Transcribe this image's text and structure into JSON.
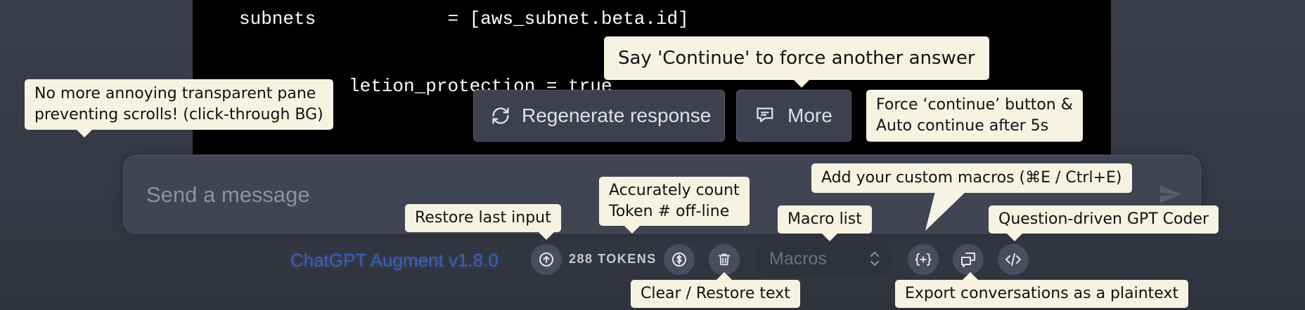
{
  "code": {
    "line1": "subnets            = [aws_subnet.beta.id]",
    "line2": "          letion_protection = true"
  },
  "actions": {
    "regenerate_label": "Regenerate response",
    "more_label": "More"
  },
  "composer": {
    "placeholder": "Send a message"
  },
  "footer": {
    "brand": "ChatGPT Augment v1.8.0",
    "tokens": "288 TOKENS",
    "macros_placeholder": "Macros"
  },
  "tooltips": {
    "continue": "Say 'Continue' to force another answer",
    "scroll_line1": "No more annoying transparent pane",
    "scroll_line2": "preventing scrolls! (click-through BG)",
    "force_line1": "Force ‘continue’ button &",
    "force_line2": "Auto continue after 5s",
    "custom_macros": "Add your custom macros (⌘E / Ctrl+E)",
    "count_line1": "Accurately count",
    "count_line2": "Token # off-line",
    "restore": "Restore last input",
    "macro_list": "Macro list",
    "coder": "Question-driven GPT Coder",
    "clear": "Clear / Restore text",
    "export": "Export conversations as a plaintext"
  },
  "colors": {
    "background": "#3b3e4b",
    "code_bg": "#000000",
    "tooltip_bg": "#f7f3e3",
    "button_bg": "#3d404e",
    "brand_text": "#3b5fb6"
  }
}
